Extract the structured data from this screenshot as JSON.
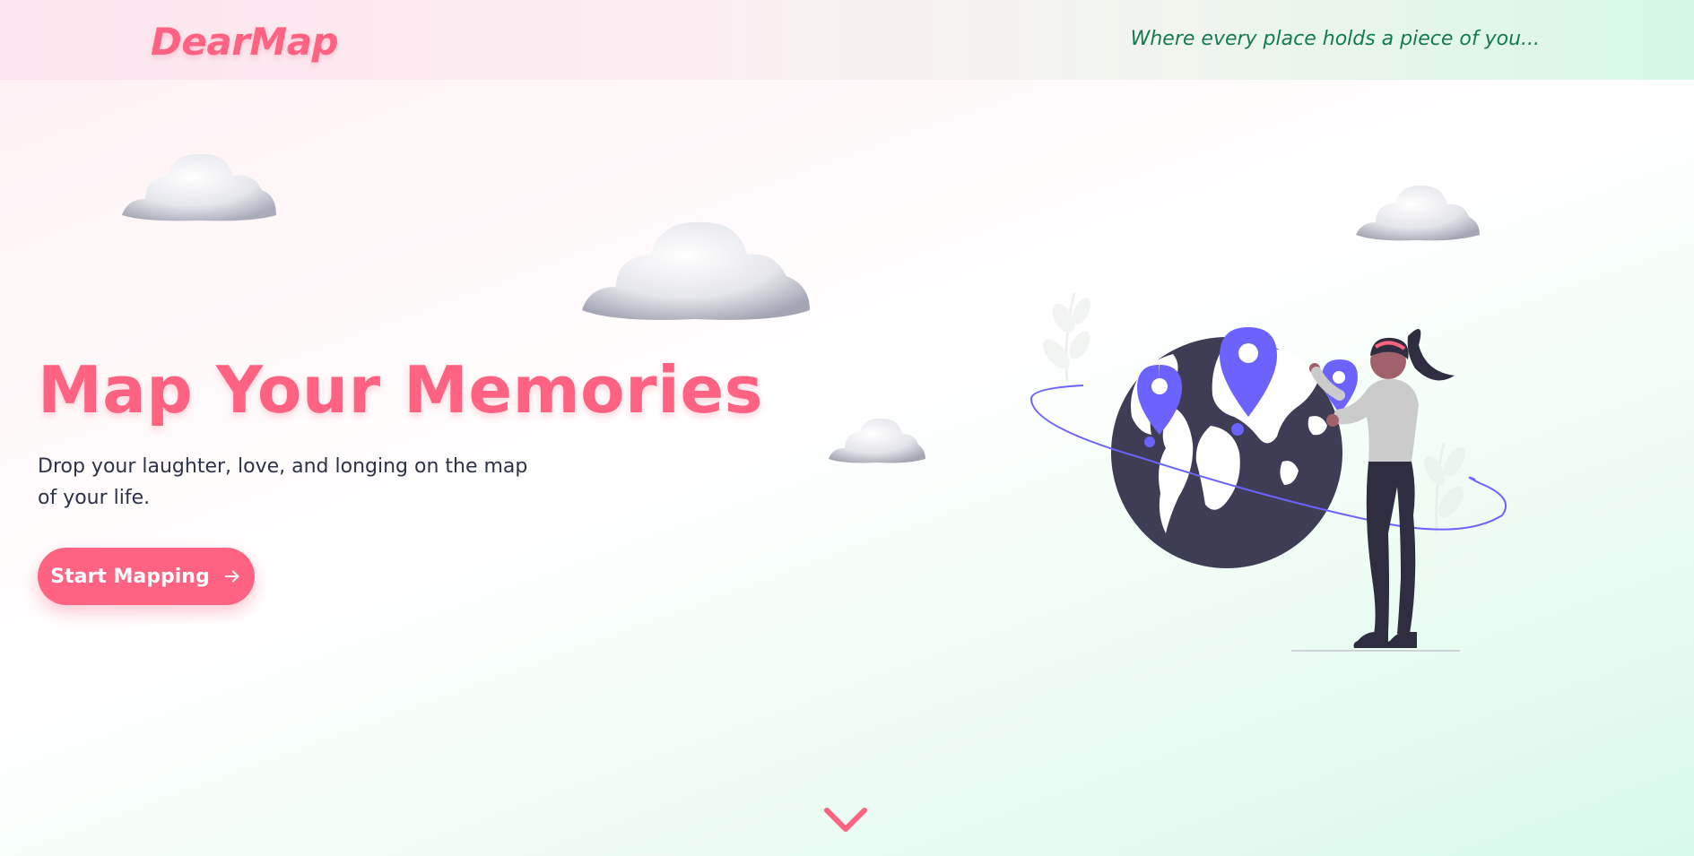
{
  "header": {
    "logo": "DearMap",
    "tagline": "Where every place holds a piece of you..."
  },
  "hero": {
    "title": "Map Your Memories",
    "subtitle": "Drop your laughter, love, and longing on the map of your life.",
    "cta_label": "Start Mapping",
    "cta_icon": "arrow-right-icon"
  },
  "decor": {
    "clouds": [
      "cloud-icon",
      "cloud-icon",
      "cloud-icon",
      "cloud-icon"
    ],
    "illustration": "woman-with-globe-and-pins-illustration",
    "scroll_icon": "chevron-down-icon"
  },
  "colors": {
    "brand": "#ff6381",
    "tagline": "#157a52",
    "pin": "#6c63ff",
    "globe": "#3f3d56"
  }
}
